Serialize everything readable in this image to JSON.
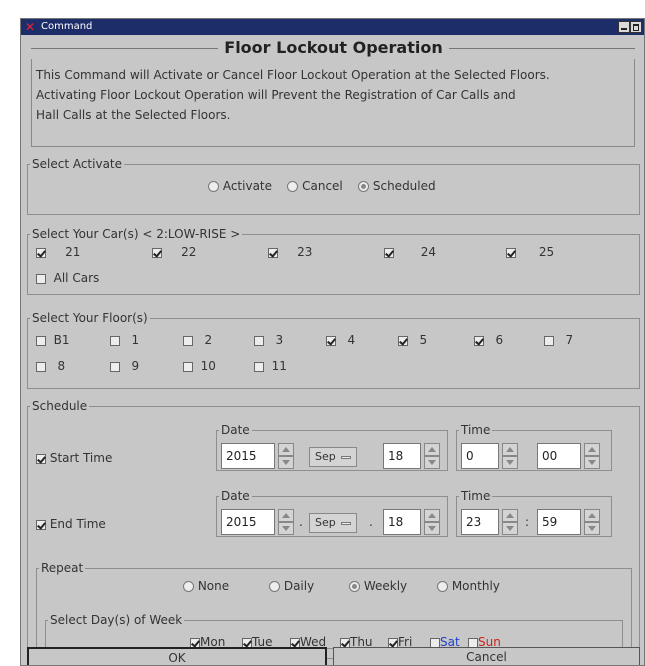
{
  "window": {
    "title": "Command"
  },
  "header": {
    "title": "Floor Lockout Operation"
  },
  "description": {
    "line1": "This Command will Activate or Cancel Floor Lockout Operation at the Selected Floors.",
    "line2": "Activating Floor Lockout Operation will Prevent the Registration of Car Calls and",
    "line3": "Hall Calls at the Selected Floors."
  },
  "activate": {
    "legend": "Select Activate",
    "options": [
      {
        "label": "Activate",
        "checked": false
      },
      {
        "label": "Cancel",
        "checked": false
      },
      {
        "label": "Scheduled",
        "checked": true
      }
    ]
  },
  "cars": {
    "legend": "Select Your Car(s)  < 2:LOW-RISE >",
    "items": [
      {
        "label": "21",
        "checked": true
      },
      {
        "label": "22",
        "checked": true
      },
      {
        "label": "23",
        "checked": true
      },
      {
        "label": "24",
        "checked": true
      },
      {
        "label": "25",
        "checked": true
      }
    ],
    "all": {
      "label": "All Cars",
      "checked": false
    }
  },
  "floors": {
    "legend": "Select Your Floor(s)",
    "row1": [
      {
        "label": "B1",
        "checked": false
      },
      {
        "label": "1",
        "checked": false
      },
      {
        "label": "2",
        "checked": false
      },
      {
        "label": "3",
        "checked": false
      },
      {
        "label": "4",
        "checked": true
      },
      {
        "label": "5",
        "checked": true
      },
      {
        "label": "6",
        "checked": true
      },
      {
        "label": "7",
        "checked": false
      }
    ],
    "row2": [
      {
        "label": "8",
        "checked": false
      },
      {
        "label": "9",
        "checked": false
      },
      {
        "label": "10",
        "checked": false
      },
      {
        "label": "11",
        "checked": false
      }
    ]
  },
  "schedule": {
    "legend": "Schedule",
    "start": {
      "label": "Start Time",
      "checked": true,
      "date_legend": "Date",
      "time_legend": "Time",
      "year": "2015",
      "month": "Sep",
      "day": "18",
      "hour": "0",
      "minute": "00"
    },
    "end": {
      "label": "End Time",
      "checked": true,
      "date_legend": "Date",
      "time_legend": "Time",
      "year": "2015",
      "month": "Sep",
      "day": "18",
      "hour": "23",
      "minute": "59",
      "date_sep": ".",
      "time_sep": ":"
    },
    "repeat": {
      "legend": "Repeat",
      "options": [
        {
          "label": "None",
          "checked": false
        },
        {
          "label": "Daily",
          "checked": false
        },
        {
          "label": "Weekly",
          "checked": true
        },
        {
          "label": "Monthly",
          "checked": false
        }
      ],
      "days_legend": "Select Day(s) of Week",
      "days": [
        {
          "label": "Mon",
          "checked": true,
          "color": "#222222"
        },
        {
          "label": "Tue",
          "checked": true,
          "color": "#222222"
        },
        {
          "label": "Wed",
          "checked": true,
          "color": "#222222"
        },
        {
          "label": "Thu",
          "checked": true,
          "color": "#222222"
        },
        {
          "label": "Fri",
          "checked": true,
          "color": "#222222"
        },
        {
          "label": "Sat",
          "checked": false,
          "color": "#1e3fd0"
        },
        {
          "label": "Sun",
          "checked": false,
          "color": "#d01e1e"
        }
      ]
    }
  },
  "buttons": {
    "ok": "OK",
    "cancel": "Cancel"
  }
}
